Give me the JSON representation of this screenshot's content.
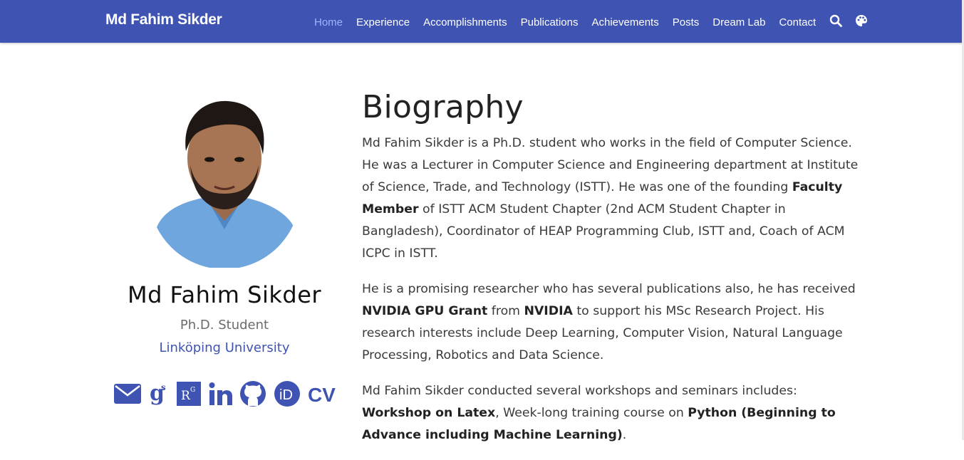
{
  "nav": {
    "brand": "Md Fahim Sikder",
    "items": [
      {
        "label": "Home",
        "active": true
      },
      {
        "label": "Experience",
        "active": false
      },
      {
        "label": "Accomplishments",
        "active": false
      },
      {
        "label": "Publications",
        "active": false
      },
      {
        "label": "Achievements",
        "active": false
      },
      {
        "label": "Posts",
        "active": false
      },
      {
        "label": "Dream Lab",
        "active": false
      },
      {
        "label": "Contact",
        "active": false
      }
    ],
    "icons": [
      "search-icon",
      "palette-icon"
    ]
  },
  "profile": {
    "name": "Md Fahim Sikder",
    "role": "Ph.D. Student",
    "organization": "Linköping University",
    "social": [
      "email-icon",
      "google-scholar-icon",
      "researchgate-icon",
      "linkedin-icon",
      "github-icon",
      "orcid-icon",
      "cv-icon"
    ],
    "cv_label": "CV"
  },
  "biography": {
    "heading": "Biography",
    "p1": {
      "a": "Md Fahim Sikder is a Ph.D. student who works in the field of Computer Science. He was a Lecturer in Computer Science and Engineering department at Institute of Science, Trade, and Technology (ISTT). He was one of the founding ",
      "b1": "Faculty Member",
      "c": " of ISTT ACM Student Chapter (2nd ACM Student Chapter in Bangladesh), Coordinator of HEAP Programming Club, ISTT and, Coach of ACM ICPC in ISTT."
    },
    "p2": {
      "a": "He is a promising researcher who has several publications also, he has received ",
      "b1": "NVIDIA GPU Grant",
      "c": " from ",
      "b2": "NVIDIA",
      "d": " to support his MSc Research Project. His research interests include Deep Learning, Computer Vision, Natural Language Processing, Robotics and Data Science."
    },
    "p3": {
      "a": "Md Fahim Sikder conducted several workshops and seminars includes: ",
      "b1": "Workshop on Latex",
      "c": ", Week-long training course on ",
      "b2": "Python (Beginning to Advance including Machine Learning)",
      "d": "."
    }
  },
  "colors": {
    "accent": "#3e53b2",
    "nav_active": "#9fb3ff"
  }
}
